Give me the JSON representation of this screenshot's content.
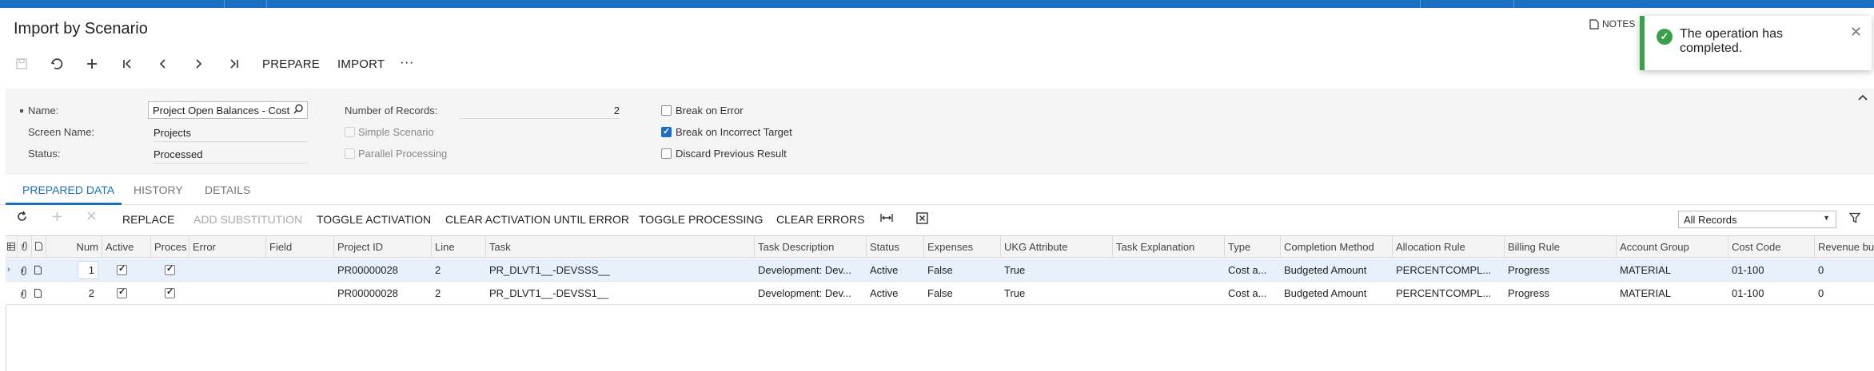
{
  "page": {
    "title": "Import by Scenario"
  },
  "toolbar": {
    "icons": {
      "save": "save-icon",
      "undo": "undo-icon",
      "add": "plus-icon",
      "first": "first-icon",
      "prev": "prev-icon",
      "next": "next-icon",
      "last": "last-icon"
    },
    "prepare_label": "PREPARE",
    "import_label": "IMPORT",
    "more_label": "···"
  },
  "notes": {
    "label": "NOTES"
  },
  "toast": {
    "message": "The operation has completed.",
    "status_color": "#3aa04a"
  },
  "summary": {
    "name_label": "Name:",
    "name_value": "Project Open Balances - Cost",
    "screen_name_label": "Screen Name:",
    "screen_name_value": "Projects",
    "status_label": "Status:",
    "status_value": "Processed",
    "records_label": "Number of Records:",
    "records_value": "2",
    "simple_scenario_label": "Simple Scenario",
    "parallel_processing_label": "Parallel Processing",
    "break_on_error_label": "Break on Error",
    "break_on_incorrect_target_label": "Break on Incorrect Target",
    "discard_previous_result_label": "Discard Previous Result",
    "break_on_incorrect_target_checked": true
  },
  "tabs": [
    {
      "label": "PREPARED DATA",
      "active": true
    },
    {
      "label": "HISTORY",
      "active": false
    },
    {
      "label": "DETAILS",
      "active": false
    }
  ],
  "grid_toolbar": {
    "replace": "REPLACE",
    "add_substitution": "ADD SUBSTITUTION",
    "toggle_activation": "TOGGLE ACTIVATION",
    "clear_activation_until_error": "CLEAR ACTIVATION UNTIL ERROR",
    "toggle_processing": "TOGGLE PROCESSING",
    "clear_errors": "CLEAR ERRORS",
    "filter_value": "All Records"
  },
  "grid": {
    "columns": [
      "Num",
      "Active",
      "Proces",
      "Error",
      "Field",
      "Project ID",
      "Line",
      "Task",
      "Task Description",
      "Status",
      "Expenses",
      "UKG Attribute",
      "Task Explanation",
      "Type",
      "Completion Method",
      "Allocation Rule",
      "Billing Rule",
      "Account Group",
      "Cost Code",
      "Revenue bud"
    ],
    "rows": [
      {
        "num": "1",
        "project_id": "PR00000028",
        "line": "2",
        "task": "PR_DLVT1__-DEVSSS__",
        "task_description": "Development: Dev...",
        "status": "Active",
        "expenses": "False",
        "ukg_attribute": "True",
        "type": "Cost a...",
        "completion_method": "Budgeted Amount",
        "allocation_rule": "PERCENTCOMPL...",
        "billing_rule": "Progress",
        "account_group": "MATERIAL",
        "cost_code": "01-100",
        "revenue_budget": "0"
      },
      {
        "num": "2",
        "project_id": "PR00000028",
        "line": "2",
        "task": "PR_DLVT1__-DEVSS1__",
        "task_description": "Development: Dev...",
        "status": "Active",
        "expenses": "False",
        "ukg_attribute": "True",
        "type": "Cost a...",
        "completion_method": "Budgeted Amount",
        "allocation_rule": "PERCENTCOMPL...",
        "billing_rule": "Progress",
        "account_group": "MATERIAL",
        "cost_code": "01-100",
        "revenue_budget": "0"
      }
    ]
  },
  "colors": {
    "accent": "#1b6fc2",
    "success": "#3aa04a",
    "selected_row": "#e8f1fb"
  }
}
